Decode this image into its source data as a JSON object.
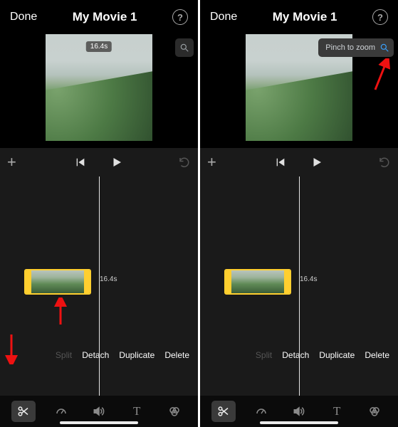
{
  "header": {
    "done_label": "Done",
    "title": "My Movie 1",
    "help_glyph": "?"
  },
  "preview": {
    "duration_badge": "16.4s",
    "zoom_hint": "Pinch to zoom"
  },
  "timeline": {
    "clip_duration": "16.4s"
  },
  "actions": {
    "split": "Split",
    "detach": "Detach",
    "duplicate": "Duplicate",
    "delete": "Delete"
  }
}
